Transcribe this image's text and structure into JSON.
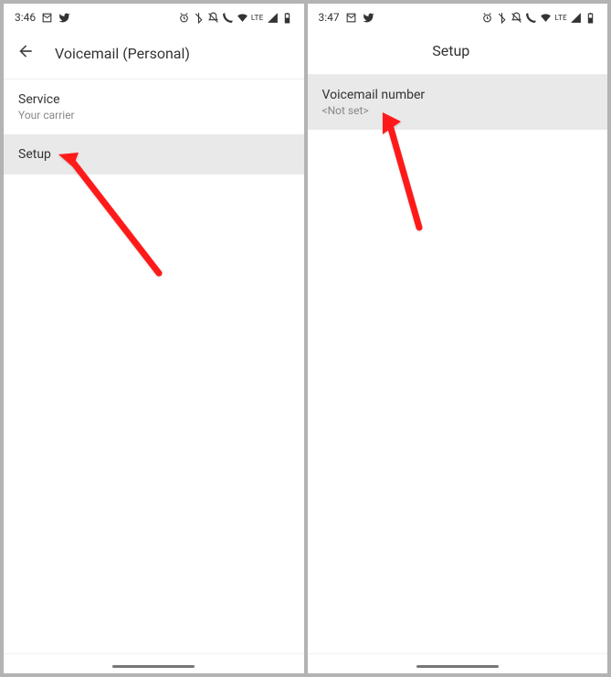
{
  "screen1": {
    "status": {
      "time": "3:46",
      "lte": "LTE"
    },
    "header": {
      "title": "Voicemail (Personal)"
    },
    "items": [
      {
        "title": "Service",
        "subtitle": "Your carrier",
        "highlighted": false
      },
      {
        "title": "Setup",
        "subtitle": "",
        "highlighted": true
      }
    ]
  },
  "screen2": {
    "status": {
      "time": "3:47",
      "lte": "LTE"
    },
    "header": {
      "title": "Setup"
    },
    "items": [
      {
        "title": "Voicemail number",
        "subtitle": "<Not set>",
        "highlighted": true
      }
    ]
  },
  "annotations": {
    "arrow_color": "#ff1a1a"
  }
}
